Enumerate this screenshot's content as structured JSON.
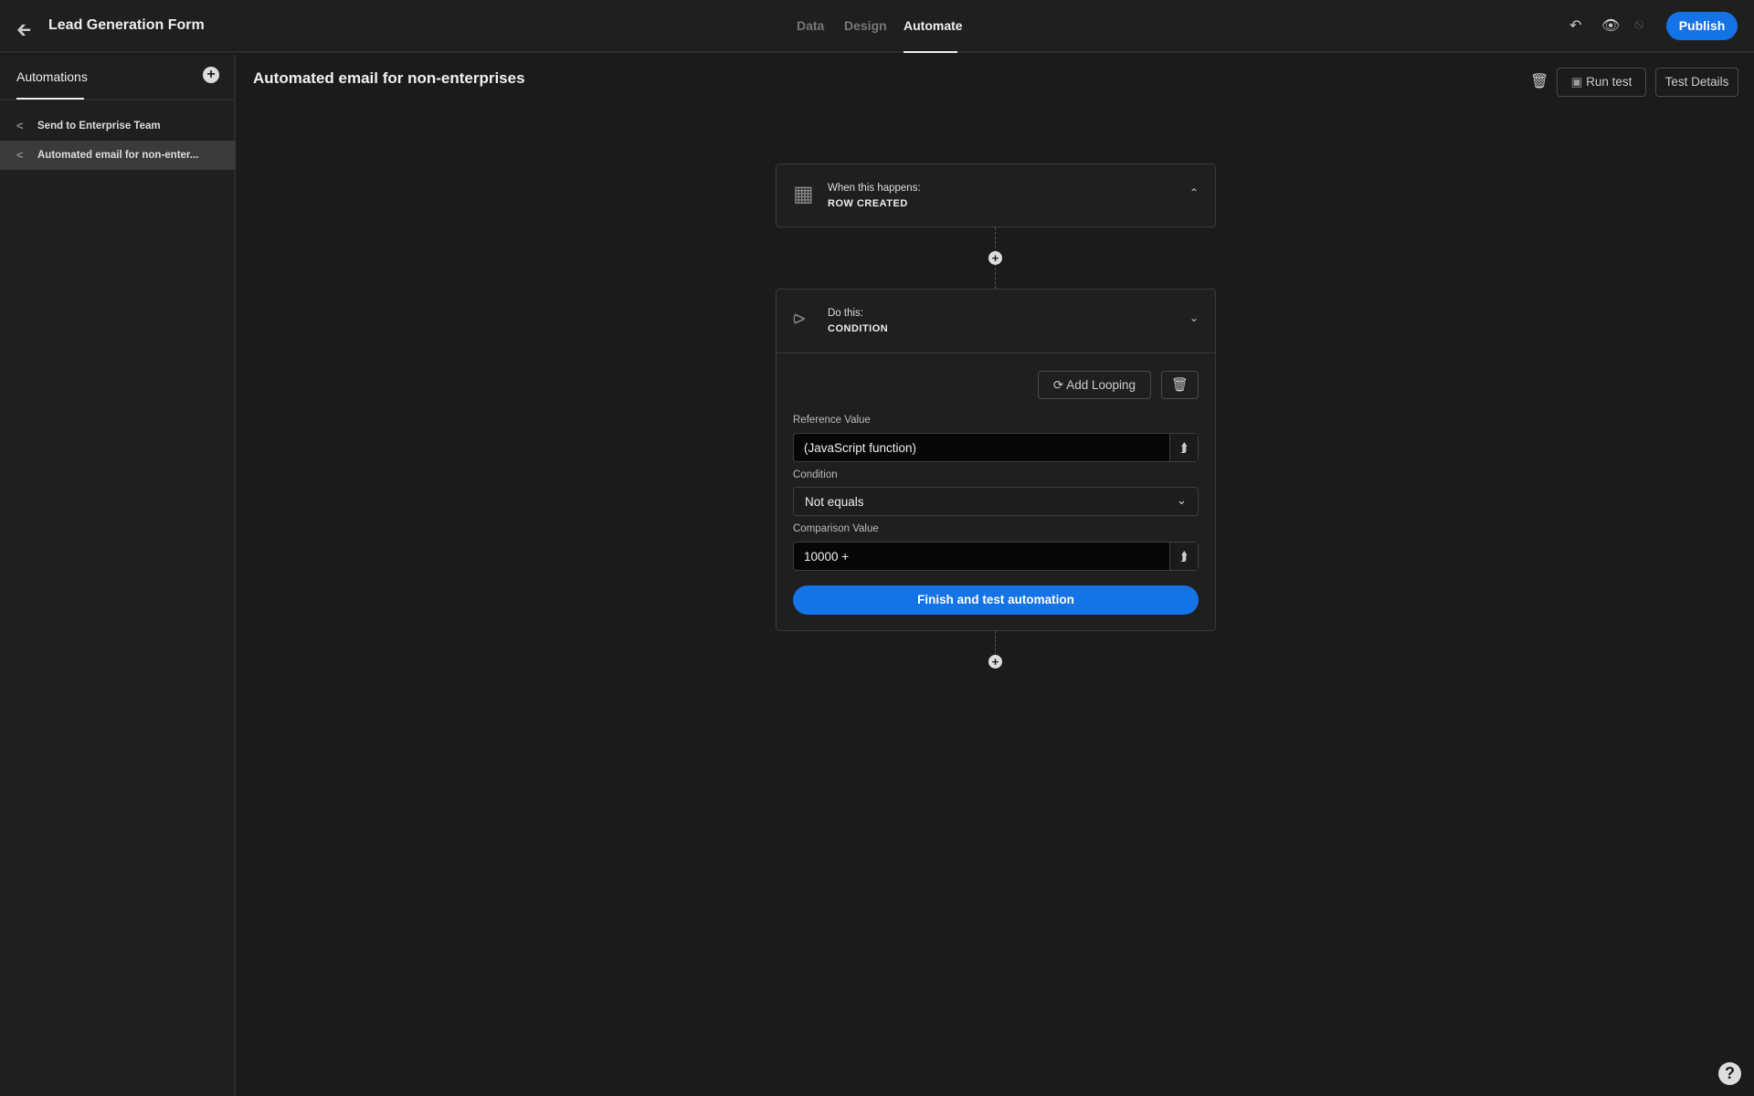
{
  "header": {
    "back_icon": "arrow-left-icon",
    "app_title": "Lead Generation Form",
    "tabs": [
      {
        "label": "Data",
        "active": false
      },
      {
        "label": "Design",
        "active": false
      },
      {
        "label": "Automate",
        "active": true
      }
    ],
    "icons": [
      "undo-icon",
      "preview-eye-icon",
      "deploy-disabled-icon"
    ],
    "publish_label": "Publish"
  },
  "sidebar": {
    "title": "Automations",
    "add_icon": "plus-circle-icon",
    "items": [
      {
        "label": "Send to Enterprise Team",
        "icon": "share-icon",
        "selected": false
      },
      {
        "label": "Automated email for non-enter...",
        "icon": "share-icon",
        "selected": true
      }
    ]
  },
  "main": {
    "title": "Automated email for non-enterprises",
    "delete_icon": "trash-icon",
    "run_test_label": "Run test",
    "test_details_label": "Test Details",
    "trigger": {
      "subtitle": "When this happens:",
      "name": "ROW CREATED",
      "icon": "table-row-add-icon",
      "expanded": true
    },
    "action": {
      "subtitle": "Do this:",
      "name": "CONDITION",
      "icon": "share-node-icon",
      "add_looping_label": "Add Looping",
      "reference_label": "Reference Value",
      "reference_value": "(JavaScript function)",
      "condition_label": "Condition",
      "condition_value": "Not equals",
      "comparison_label": "Comparison Value",
      "comparison_value": "10000 +",
      "finish_label": "Finish and test automation"
    }
  },
  "help_label": "?",
  "colors": {
    "accent": "#1473e6",
    "background": "#1b1b1b",
    "panel": "#1f1f1f"
  }
}
